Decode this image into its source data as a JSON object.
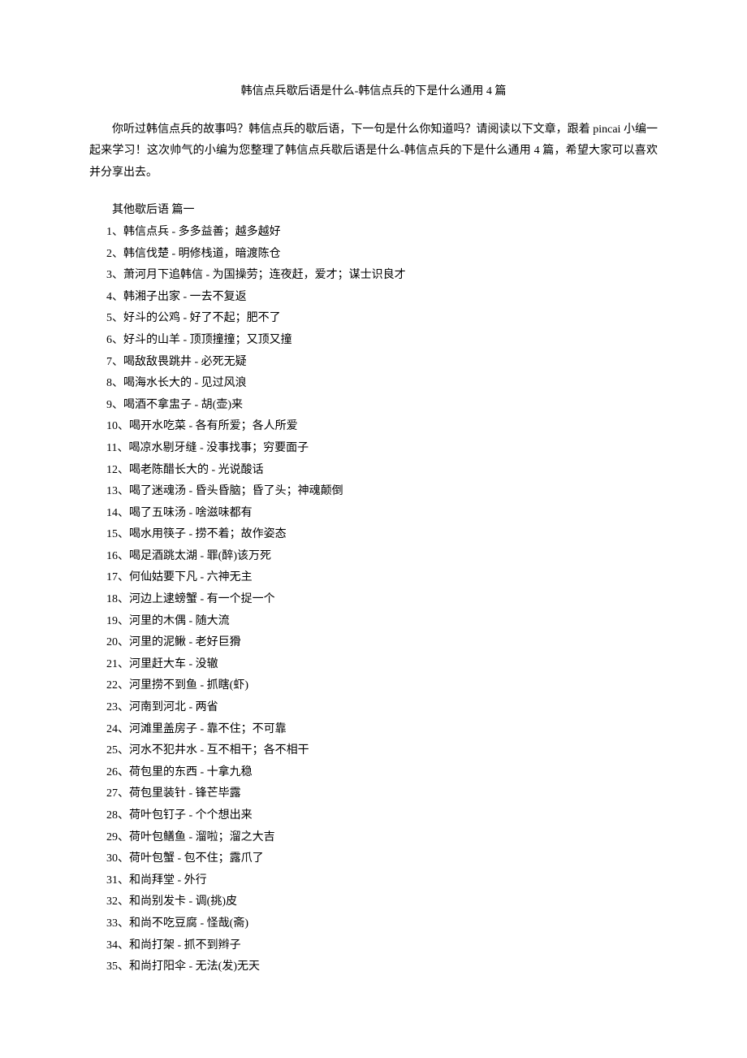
{
  "title": "韩信点兵歇后语是什么-韩信点兵的下是什么通用 4 篇",
  "intro": "你听过韩信点兵的故事吗？韩信点兵的歇后语，下一句是什么你知道吗？请阅读以下文章，跟着 pincai 小编一起来学习！这次帅气的小编为您整理了韩信点兵歇后语是什么-韩信点兵的下是什么通用 4 篇，希望大家可以喜欢并分享出去。",
  "section_heading": "其他歇后语 篇一",
  "items": [
    "1、韩信点兵 - 多多益善；越多越好",
    "2、韩信伐楚 - 明修栈道，暗渡陈仓",
    "3、萧河月下追韩信 - 为国操劳；连夜赶，爱才；谋士识良才",
    "4、韩湘子出家 - 一去不复返",
    "5、好斗的公鸡 - 好了不起；肥不了",
    "6、好斗的山羊 - 顶顶撞撞；又顶又撞",
    "7、喝敌敌畏跳井 - 必死无疑",
    "8、喝海水长大的 - 见过风浪",
    "9、喝酒不拿盅子 - 胡(壶)来",
    "10、喝开水吃菜 - 各有所爱；各人所爱",
    "11、喝凉水剔牙缝 - 没事找事；穷要面子",
    "12、喝老陈醋长大的 - 光说酸话",
    "13、喝了迷魂汤 - 昏头昏脑；昏了头；神魂颠倒",
    "14、喝了五味汤 - 啥滋味都有",
    "15、喝水用筷子 - 捞不着；故作姿态",
    "16、喝足酒跳太湖 - 罪(醉)该万死",
    "17、何仙姑要下凡 - 六神无主",
    "18、河边上逮螃蟹 - 有一个捉一个",
    "19、河里的木偶 - 随大流",
    "20、河里的泥鳅 - 老好巨猾",
    "21、河里赶大车 - 没辙",
    "22、河里捞不到鱼 - 抓瞎(虾)",
    "23、河南到河北 - 两省",
    "24、河滩里盖房子 - 靠不住；不可靠",
    "25、河水不犯井水 - 互不相干；各不相干",
    "26、荷包里的东西 - 十拿九稳",
    "27、荷包里装针 - 锋芒毕露",
    "28、荷叶包钉子 - 个个想出来",
    "29、荷叶包鳝鱼 - 溜啦；溜之大吉",
    "30、荷叶包蟹 - 包不住；露爪了",
    "31、和尚拜堂 - 外行",
    "32、和尚别发卡 - 调(挑)皮",
    "33、和尚不吃豆腐 - 怪哉(斋)",
    "34、和尚打架 - 抓不到辫子",
    "35、和尚打阳伞 - 无法(发)无天"
  ]
}
